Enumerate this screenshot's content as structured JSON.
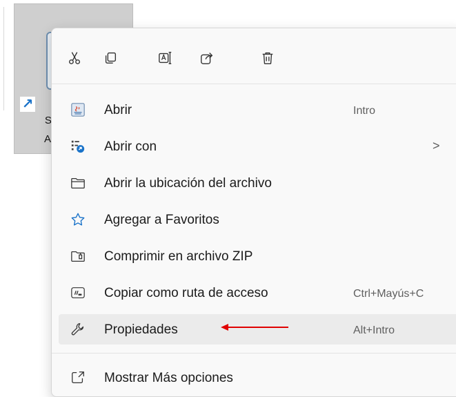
{
  "file_tile": {
    "label_line1": "SIA",
    "label_line2": "Acc"
  },
  "quick_actions": [
    {
      "name": "cut",
      "icon": "scissors-icon"
    },
    {
      "name": "copy",
      "icon": "copy-icon"
    },
    {
      "name": "rename",
      "icon": "rename-icon"
    },
    {
      "name": "share",
      "icon": "share-icon"
    },
    {
      "name": "delete",
      "icon": "trash-icon"
    }
  ],
  "menu": {
    "items": [
      {
        "label": "Abrir",
        "shortcut": "Intro",
        "icon": "java-app-icon"
      },
      {
        "label": "Abrir con",
        "shortcut": "",
        "icon": "open-with-icon",
        "submenu_chevron": ">"
      },
      {
        "label": "Abrir la ubicación del archivo",
        "shortcut": "",
        "icon": "folder-icon"
      },
      {
        "label": "Agregar a Favoritos",
        "shortcut": "",
        "icon": "star-icon"
      },
      {
        "label": "Comprimir en archivo ZIP",
        "shortcut": "",
        "icon": "zip-folder-icon"
      },
      {
        "label": "Copiar como ruta de acceso",
        "shortcut": "Ctrl+Mayús+C",
        "icon": "path-icon"
      },
      {
        "label": "Propiedades",
        "shortcut": "Alt+Intro",
        "icon": "wrench-icon",
        "highlighted": true
      },
      {
        "label": "Mostrar Más opciones",
        "shortcut": "",
        "icon": "more-options-icon"
      }
    ]
  },
  "colors": {
    "menu_bg": "#f9f9f9",
    "hover_bg": "#ebebeb",
    "accent_blue": "#1a73c9",
    "annotation_red": "#e00000"
  }
}
